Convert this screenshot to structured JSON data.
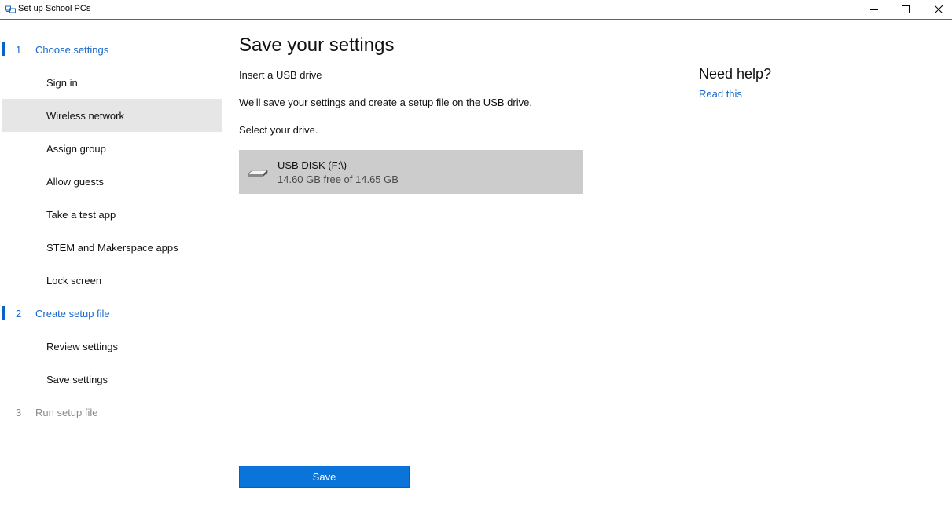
{
  "window": {
    "title": "Set up School PCs",
    "controls": [
      "minimize",
      "maximize",
      "close"
    ]
  },
  "sidebar": {
    "steps": [
      {
        "number": "1",
        "label": "Choose settings",
        "state": "active",
        "items": [
          {
            "label": "Sign in",
            "selected": false
          },
          {
            "label": "Wireless network",
            "selected": true
          },
          {
            "label": "Assign group",
            "selected": false
          },
          {
            "label": "Allow guests",
            "selected": false
          },
          {
            "label": "Take a test app",
            "selected": false
          },
          {
            "label": "STEM and Makerspace apps",
            "selected": false
          },
          {
            "label": "Lock screen",
            "selected": false
          }
        ]
      },
      {
        "number": "2",
        "label": "Create setup file",
        "state": "active",
        "items": [
          {
            "label": "Review settings",
            "selected": false
          },
          {
            "label": "Save settings",
            "selected": false
          }
        ]
      },
      {
        "number": "3",
        "label": "Run setup file",
        "state": "disabled",
        "items": []
      }
    ]
  },
  "main": {
    "title": "Save your settings",
    "instruction": "Insert a USB drive",
    "description": "We'll save your settings and create a setup file on the USB drive.",
    "select_prompt": "Select your drive.",
    "drive": {
      "name": "USB DISK (F:\\)",
      "free_space": "14.60 GB free of 14.65 GB",
      "icon": "usb-drive-icon",
      "selected": true
    },
    "save_button": "Save"
  },
  "help": {
    "title": "Need help?",
    "link": "Read this"
  },
  "colors": {
    "accent": "#0a74da",
    "link": "#1967c8",
    "selected_bg": "#e6e6e6",
    "tile_bg": "#cccccc"
  }
}
